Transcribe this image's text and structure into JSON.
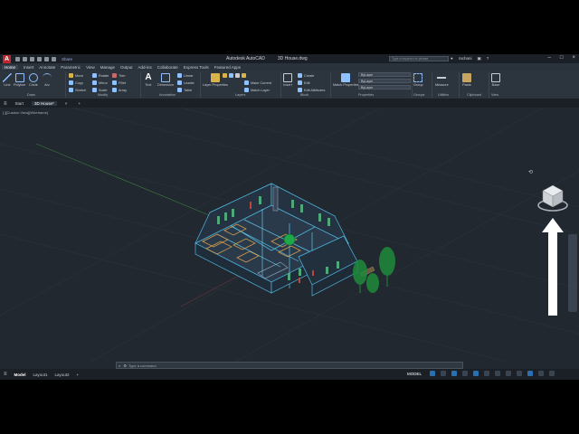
{
  "app": {
    "logo": "A",
    "share": "Share",
    "product": "Autodesk AutoCAD",
    "filename": "3D House.dwg",
    "search_placeholder": "Type a keyword or phrase",
    "user": "rachani"
  },
  "ribbon_tabs": [
    "Home",
    "Insert",
    "Annotate",
    "Parametric",
    "View",
    "Manage",
    "Output",
    "Add-ins",
    "Collaborate",
    "Express Tools",
    "Featured Apps"
  ],
  "ribbon": {
    "draw": {
      "label": "Draw",
      "tools": [
        "Line",
        "Polyline",
        "Circle",
        "Arc"
      ]
    },
    "modify": {
      "label": "Modify",
      "tools": [
        "Move",
        "Rotate",
        "Trim",
        "Copy",
        "Mirror",
        "Fillet",
        "Stretch",
        "Scale",
        "Array"
      ]
    },
    "annotation": {
      "label": "Annotation",
      "tools": [
        "Text",
        "Dimension"
      ],
      "items": [
        "Linear",
        "Leader",
        "Table"
      ]
    },
    "layers": {
      "label": "Layers",
      "tools": [
        "Layer Properties"
      ],
      "items": [
        "Make Current",
        "Match Layer"
      ]
    },
    "block": {
      "label": "Block",
      "tools": [
        "Insert"
      ],
      "items": [
        "Create",
        "Edit",
        "Edit Attributes"
      ]
    },
    "properties": {
      "label": "Properties",
      "tools": [
        "Match Properties"
      ],
      "dropdowns": [
        "ByLayer",
        "ByLayer",
        "ByLayer"
      ]
    },
    "groups": {
      "label": "Groups",
      "tools": [
        "Group"
      ]
    },
    "utilities": {
      "label": "Utilities",
      "tools": [
        "Measure"
      ]
    },
    "clipboard": {
      "label": "Clipboard",
      "tools": [
        "Paste"
      ]
    },
    "view": {
      "label": "View",
      "tools": [
        "Base"
      ]
    }
  },
  "doc_tabs": [
    "Start",
    "3D House*"
  ],
  "viewport_label": "[-][Custom View][Wireframe]",
  "cmdline": {
    "prompt": "Type a command"
  },
  "layout_tabs": [
    "Model",
    "Layout1",
    "Layout2"
  ],
  "status": {
    "model": "MODEL"
  },
  "colors": {
    "accent": "#2a6fb0",
    "viewport": "#212830",
    "brand": "#c0262d"
  }
}
